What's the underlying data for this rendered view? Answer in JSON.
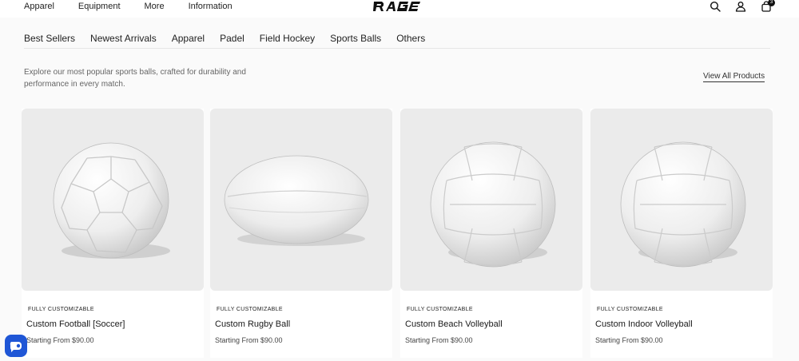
{
  "top_nav": [
    "Apparel",
    "Equipment",
    "More",
    "Information"
  ],
  "logo_text": "RAGE",
  "cart_count": "3",
  "tabs": [
    "Best Sellers",
    "Newest Arrivals",
    "Apparel",
    "Padel",
    "Field Hockey",
    "Sports Balls",
    "Others"
  ],
  "active_tab": "Sports Balls",
  "intro": "Explore our most popular sports balls, crafted for durability and performance in every match.",
  "view_all": "View All Products",
  "products": [
    {
      "tag": "FULLY CUSTOMIZABLE",
      "name": "Custom Football [Soccer]",
      "price": "Starting From $90.00"
    },
    {
      "tag": "FULLY CUSTOMIZABLE",
      "name": "Custom Rugby Ball",
      "price": "Starting From $90.00"
    },
    {
      "tag": "FULLY CUSTOMIZABLE",
      "name": "Custom Beach Volleyball",
      "price": "Starting From $90.00"
    },
    {
      "tag": "FULLY CUSTOMIZABLE",
      "name": "Custom Indoor Volleyball",
      "price": "Starting From $90.00"
    }
  ],
  "icons": [
    "search-icon",
    "user-icon",
    "bag-icon",
    "chat-icon"
  ],
  "colors": {
    "accent": "#1f56d6",
    "background": "#fafafa",
    "card_image_bg": "#ebebeb"
  }
}
